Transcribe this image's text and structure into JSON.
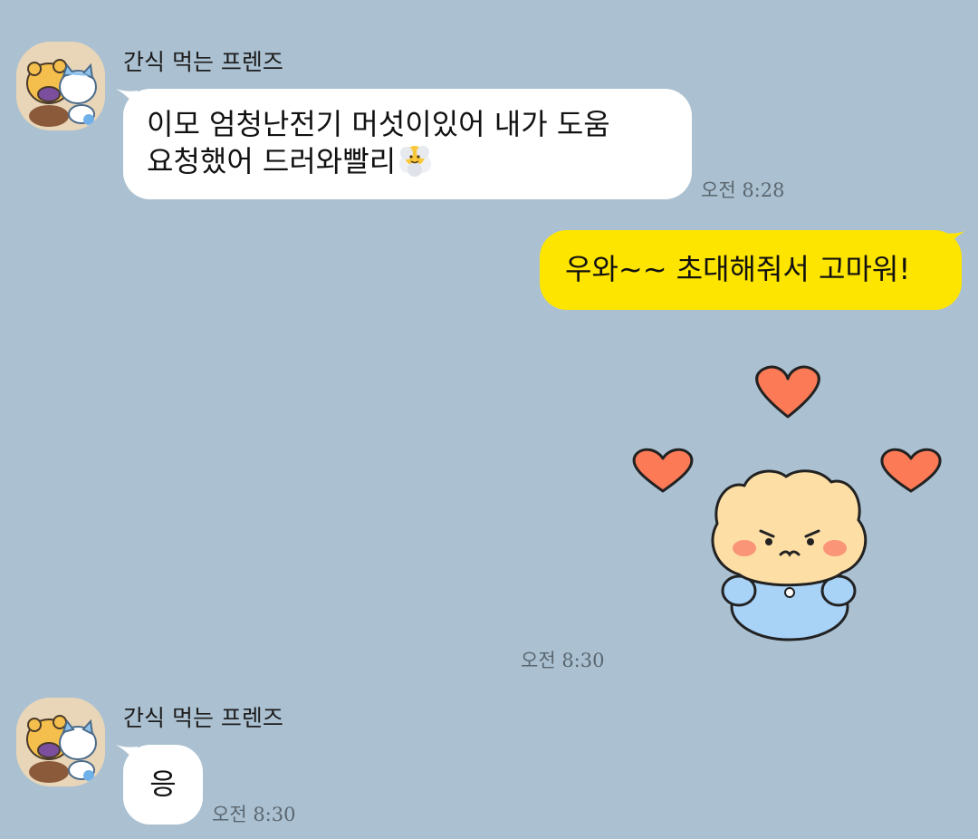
{
  "chat": {
    "messages": [
      {
        "sender": "간식 먹는 프렌즈",
        "line1": "이모 엄청난전기 머섯이있어 내가 도움",
        "line2": "요청했어 드러와빨리",
        "emoji": "face-in-clouds-icon",
        "time": "오전 8:28"
      },
      {
        "text": "우와~~ 초대해줘서 고마워!",
        "sticker": "bear-hearts-sticker",
        "time": "오전 8:30"
      },
      {
        "sender": "간식 먹는 프렌즈",
        "text": "응",
        "time": "오전 8:30"
      }
    ]
  },
  "colors": {
    "background": "#abc1d1",
    "incoming_bubble": "#ffffff",
    "outgoing_bubble": "#fee500",
    "heart": "#fc7a56",
    "sticker_face": "#fddfa6",
    "sticker_body": "#a9d2f7"
  }
}
